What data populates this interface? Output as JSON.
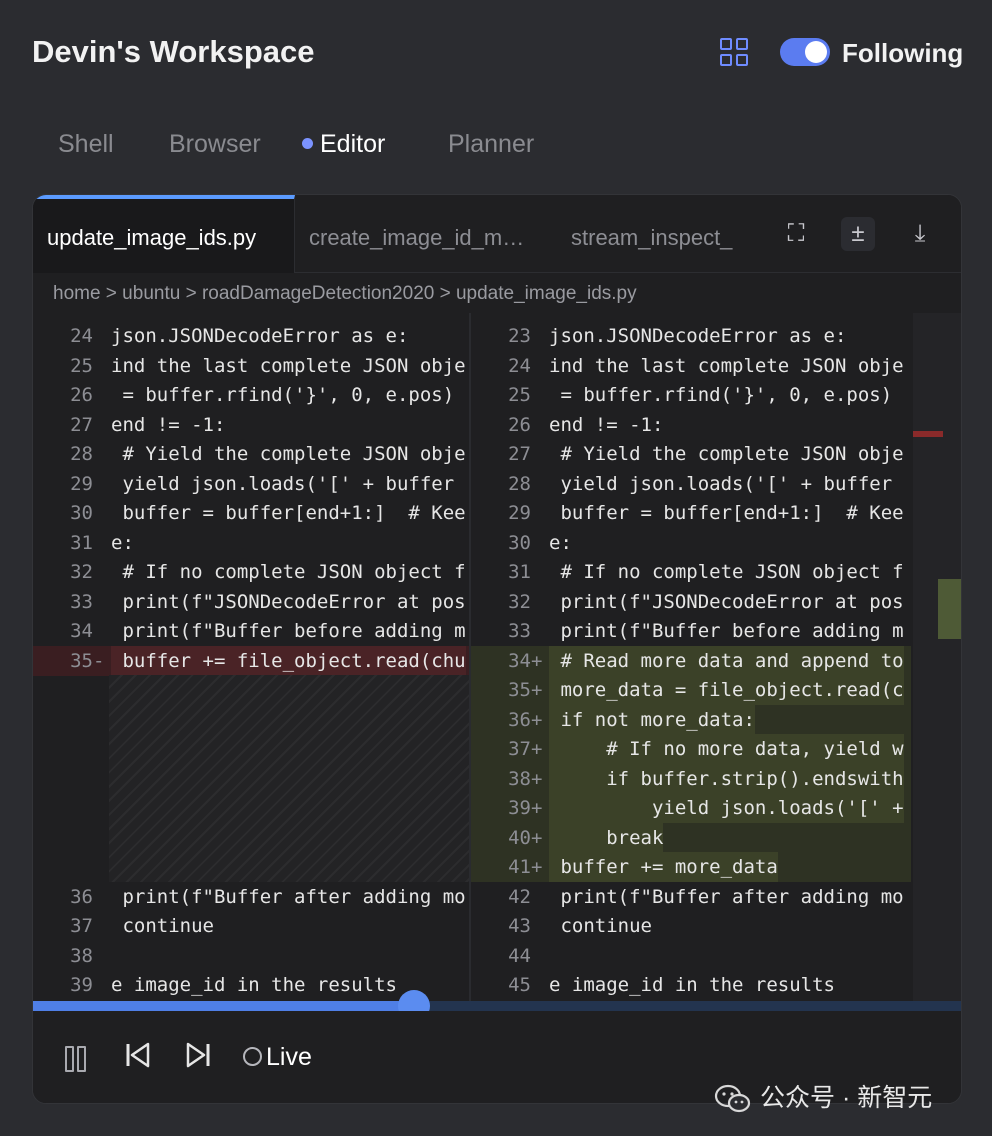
{
  "header": {
    "title": "Devin's Workspace",
    "follow_label": "Following",
    "following_on": true
  },
  "tabs": [
    {
      "label": "Shell"
    },
    {
      "label": "Browser"
    },
    {
      "label": "Editor"
    },
    {
      "label": "Planner"
    }
  ],
  "active_tab": "Editor",
  "file_tabs": [
    {
      "label": "update_image_ids.py"
    },
    {
      "label": "create_image_id_m…"
    },
    {
      "label": "stream_inspect_"
    }
  ],
  "breadcrumb": "home > ubuntu > roadDamageDetection2020 > update_image_ids.py",
  "diff_left": [
    {
      "n": "24",
      "m": "",
      "t": "json.JSONDecodeError as e:",
      "k": ""
    },
    {
      "n": "25",
      "m": "",
      "t": "ind the last complete JSON obje",
      "k": ""
    },
    {
      "n": "26",
      "m": "",
      "t": " = buffer.rfind('}', 0, e.pos)",
      "k": ""
    },
    {
      "n": "27",
      "m": "",
      "t": "end != -1:",
      "k": ""
    },
    {
      "n": "28",
      "m": "",
      "t": " # Yield the complete JSON obje",
      "k": ""
    },
    {
      "n": "29",
      "m": "",
      "t": " yield json.loads('[' + buffer",
      "k": ""
    },
    {
      "n": "30",
      "m": "",
      "t": " buffer = buffer[end+1:]  # Kee",
      "k": ""
    },
    {
      "n": "31",
      "m": "",
      "t": "e:",
      "k": ""
    },
    {
      "n": "32",
      "m": "",
      "t": " # If no complete JSON object f",
      "k": ""
    },
    {
      "n": "33",
      "m": "",
      "t": " print(f\"JSONDecodeError at pos",
      "k": ""
    },
    {
      "n": "34",
      "m": "",
      "t": " print(f\"Buffer before adding m",
      "k": ""
    },
    {
      "n": "35",
      "m": "-",
      "t": " buffer += file_object.read(chu",
      "k": "del"
    },
    {
      "n": "36",
      "m": "",
      "t": " print(f\"Buffer after adding mo",
      "k": "",
      "gap": 7
    },
    {
      "n": "37",
      "m": "",
      "t": " continue",
      "k": ""
    },
    {
      "n": "38",
      "m": "",
      "t": "",
      "k": ""
    },
    {
      "n": "39",
      "m": "",
      "t": "e image_id in the results",
      "k": ""
    }
  ],
  "diff_right": [
    {
      "n": "23",
      "m": "",
      "t": "json.JSONDecodeError as e:",
      "k": ""
    },
    {
      "n": "24",
      "m": "",
      "t": "ind the last complete JSON obje",
      "k": ""
    },
    {
      "n": "25",
      "m": "",
      "t": " = buffer.rfind('}', 0, e.pos)",
      "k": ""
    },
    {
      "n": "26",
      "m": "",
      "t": "end != -1:",
      "k": ""
    },
    {
      "n": "27",
      "m": "",
      "t": " # Yield the complete JSON obje",
      "k": ""
    },
    {
      "n": "28",
      "m": "",
      "t": " yield json.loads('[' + buffer",
      "k": ""
    },
    {
      "n": "29",
      "m": "",
      "t": " buffer = buffer[end+1:]  # Kee",
      "k": ""
    },
    {
      "n": "30",
      "m": "",
      "t": "e:",
      "k": ""
    },
    {
      "n": "31",
      "m": "",
      "t": " # If no complete JSON object f",
      "k": ""
    },
    {
      "n": "32",
      "m": "",
      "t": " print(f\"JSONDecodeError at pos",
      "k": ""
    },
    {
      "n": "33",
      "m": "",
      "t": " print(f\"Buffer before adding m",
      "k": ""
    },
    {
      "n": "34",
      "m": "+",
      "t": " # Read more data and append to",
      "k": "add"
    },
    {
      "n": "35",
      "m": "+",
      "t": " more_data = file_object.read(c",
      "k": "add"
    },
    {
      "n": "36",
      "m": "+",
      "t": " if not more_data:",
      "k": "add"
    },
    {
      "n": "37",
      "m": "+",
      "t": "     # If no more data, yield w",
      "k": "add"
    },
    {
      "n": "38",
      "m": "+",
      "t": "     if buffer.strip().endswith",
      "k": "add"
    },
    {
      "n": "39",
      "m": "+",
      "t": "         yield json.loads('[' +",
      "k": "add"
    },
    {
      "n": "40",
      "m": "+",
      "t": "     break",
      "k": "add"
    },
    {
      "n": "41",
      "m": "+",
      "t": " buffer += more_data",
      "k": "add"
    },
    {
      "n": "42",
      "m": "",
      "t": " print(f\"Buffer after adding mo",
      "k": ""
    },
    {
      "n": "43",
      "m": "",
      "t": " continue",
      "k": ""
    },
    {
      "n": "44",
      "m": "",
      "t": "",
      "k": ""
    },
    {
      "n": "45",
      "m": "",
      "t": "e image_id in the results",
      "k": ""
    }
  ],
  "playback": {
    "progress": 0.41,
    "live_label": "Live"
  },
  "watermark": "公众号 · 新智元",
  "colors": {
    "accent": "#5b8cf0",
    "deleted": "#4a2326",
    "added": "#3b4128"
  },
  "icons": [
    "grid-view-icon",
    "expand-icon",
    "diff-toggle-icon",
    "download-icon",
    "pause-icon",
    "skip-back-icon",
    "skip-forward-icon",
    "wechat-icon"
  ]
}
